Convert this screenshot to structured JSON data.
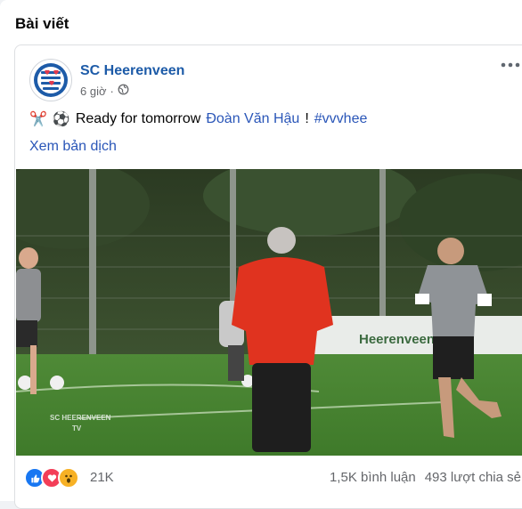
{
  "section": {
    "title": "Bài viết"
  },
  "post": {
    "author": "SC Heerenveen",
    "time": "6 giờ",
    "separator": "·",
    "privacy_icon": "globe-icon",
    "emoji_1": "✂️",
    "emoji_2": "⚽",
    "text_before": "Ready for tomorrow",
    "mention": "Đoàn Văn Hậu",
    "text_mid": "!",
    "hashtag": "#vvvhee",
    "translate_label": "Xem bản dịch",
    "more_icon": "more-icon",
    "media": {
      "watermark_line1": "SC HEERENVEEN",
      "watermark_line2": "TV",
      "banner_text": "Heerenveen  Cre"
    }
  },
  "footer": {
    "reaction_icons": [
      "like-icon",
      "love-icon",
      "wow-icon"
    ],
    "reaction_count": "21K",
    "comments": "1,5K bình luận",
    "shares": "493 lượt chia sẻ"
  },
  "colors": {
    "accent": "#1d5ba8",
    "link": "#2a56b8",
    "muted": "#65676b",
    "like": "#1877f2",
    "love": "#f33e58",
    "wow": "#f7b125"
  }
}
